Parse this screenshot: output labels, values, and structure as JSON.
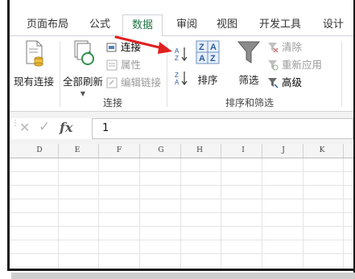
{
  "tabs": [
    "页面布局",
    "公式",
    "数据",
    "审阅",
    "视图",
    "开发工具",
    "设计"
  ],
  "active_tab": "数据",
  "ribbon": {
    "existing_connections": "现有连接",
    "refresh_all": "全部刷新",
    "connections": "连接",
    "properties": "属性",
    "edit_links": "编辑链接",
    "group_connections": "连接",
    "sort": "排序",
    "filter": "筛选",
    "clear": "清除",
    "reapply": "重新应用",
    "advanced": "高级",
    "group_sort_filter": "排序和筛选"
  },
  "formula_bar": {
    "cancel_symbol": "✕",
    "enter_symbol": "✓",
    "fx_label": "fx",
    "content": "1"
  },
  "columns": [
    "D",
    "E",
    "F",
    "G",
    "H",
    "I",
    "J",
    "K"
  ],
  "colors": {
    "accent": "#217346",
    "arrow": "#e02020"
  }
}
